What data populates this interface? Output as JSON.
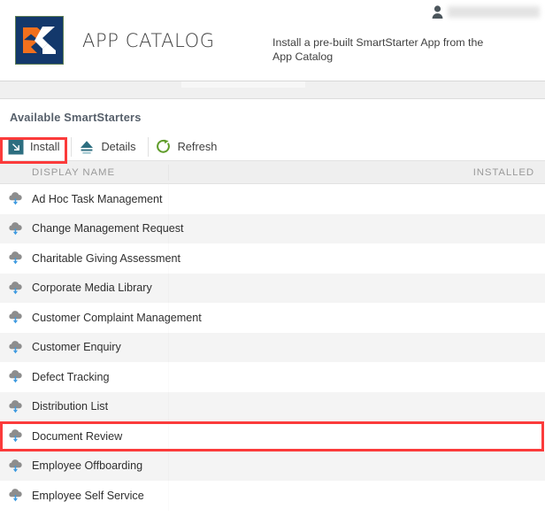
{
  "header": {
    "brand_title": "APP CATALOG",
    "subtitle": "Install a pre-built SmartStarter App from the App Catalog",
    "user_icon": "user-icon",
    "user_name": "",
    "logo_icon": "app-catalog-logo-icon"
  },
  "panel": {
    "title": "Available SmartStarters"
  },
  "toolbar": {
    "buttons": [
      {
        "label": "Install",
        "icon": "install-arrow-icon",
        "highlighted": true
      },
      {
        "label": "Details",
        "icon": "details-eject-icon",
        "highlighted": false
      },
      {
        "label": "Refresh",
        "icon": "refresh-circular-arrow-icon",
        "highlighted": false
      }
    ]
  },
  "table": {
    "columns": [
      {
        "key": "display_name",
        "label": "DISPLAY NAME"
      },
      {
        "key": "installed",
        "label": "INSTALLED"
      }
    ],
    "rows": [
      {
        "display_name": "Ad Hoc Task Management",
        "installed": "",
        "icon": "cloud-download-icon",
        "highlighted": false
      },
      {
        "display_name": "Change Management Request",
        "installed": "",
        "icon": "cloud-download-icon",
        "highlighted": false
      },
      {
        "display_name": "Charitable Giving Assessment",
        "installed": "",
        "icon": "cloud-download-icon",
        "highlighted": false
      },
      {
        "display_name": "Corporate Media Library",
        "installed": "",
        "icon": "cloud-download-icon",
        "highlighted": false
      },
      {
        "display_name": "Customer Complaint Management",
        "installed": "",
        "icon": "cloud-download-icon",
        "highlighted": false
      },
      {
        "display_name": "Customer Enquiry",
        "installed": "",
        "icon": "cloud-download-icon",
        "highlighted": false
      },
      {
        "display_name": "Defect Tracking",
        "installed": "",
        "icon": "cloud-download-icon",
        "highlighted": false
      },
      {
        "display_name": "Distribution List",
        "installed": "",
        "icon": "cloud-download-icon",
        "highlighted": false
      },
      {
        "display_name": "Document Review",
        "installed": "",
        "icon": "cloud-download-icon",
        "highlighted": true
      },
      {
        "display_name": "Employee Offboarding",
        "installed": "",
        "icon": "cloud-download-icon",
        "highlighted": false
      },
      {
        "display_name": "Employee Self Service",
        "installed": "",
        "icon": "cloud-download-icon",
        "highlighted": false
      }
    ]
  },
  "colors": {
    "logo_background": "#13386b",
    "logo_accent": "#f2701d",
    "install_icon": "#2d6e80",
    "details_icon": "#2d6e80",
    "refresh_icon": "#5f9c2a",
    "highlight_border": "#fb3b3b",
    "row_alt_background": "#f4f4f4",
    "header_text": "#9a9a9a",
    "cloud_icon": "#8d8d8d",
    "cloud_arrow": "#3d9ae0"
  }
}
